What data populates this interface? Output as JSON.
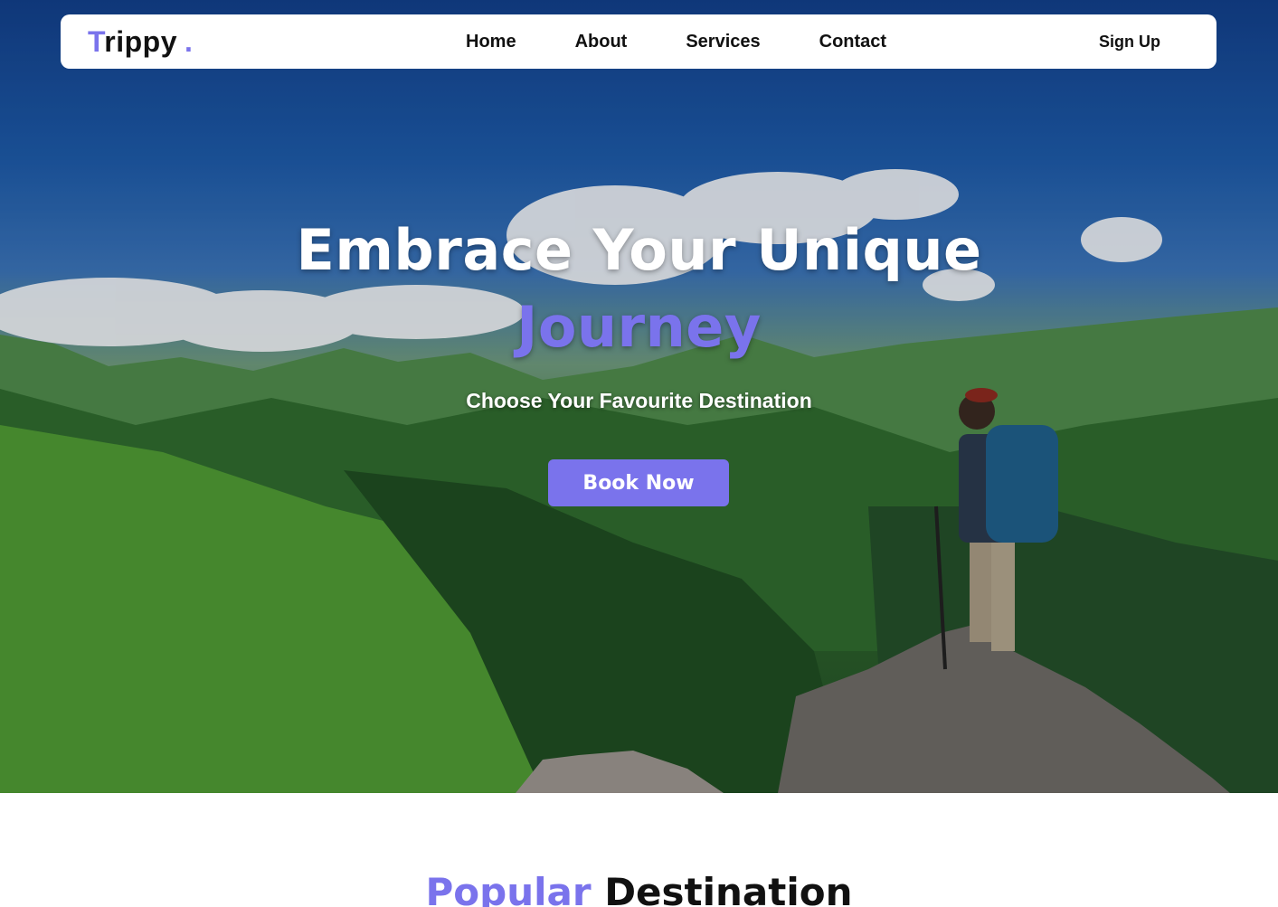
{
  "brand": {
    "logo_first_letter": "T",
    "logo_rest": "rippy",
    "logo_dot": ".",
    "accent_color": "#7a73ec"
  },
  "nav": {
    "links": [
      {
        "label": "Home"
      },
      {
        "label": "About"
      },
      {
        "label": "Services"
      },
      {
        "label": "Contact"
      }
    ],
    "signup_label": "Sign Up"
  },
  "hero": {
    "title_line1": "Embrace Your Unique",
    "title_line2": "Journey",
    "subtitle": "Choose Your Favourite Destination",
    "cta_label": "Book Now",
    "background_image": "mountain-hiker-photo"
  },
  "popular": {
    "title_accent": "Popular",
    "title_rest": "Destination"
  }
}
